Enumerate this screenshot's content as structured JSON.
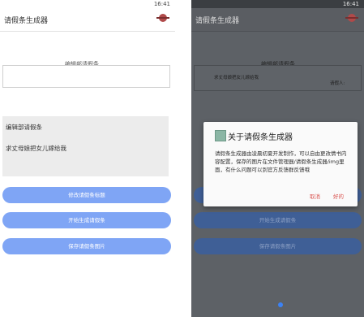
{
  "status_time": "16:41",
  "app": {
    "title": "请假条生成器"
  },
  "editor": {
    "legend": "编辑部请假条",
    "input_value": ""
  },
  "preview": {
    "title": "编辑部请假条",
    "body": "求丈母娘把女儿嫁给我"
  },
  "buttons": {
    "modify": "修改请假条标题",
    "generate": "开始生成请假条",
    "save": "保存请假条图片"
  },
  "right_preview": {
    "line1": "求丈母娘把女儿嫁给我",
    "signature": "请假人:"
  },
  "dialog": {
    "title": "关于请假条生成器",
    "message": "请假条生成器由凌晨初夏开发制作，可以自由更改情书内容配置，保存的图片在文件管理器/请假条生成器/img里面，有什么问题可以到官方反馈群反馈哦",
    "cancel": "取消",
    "ok": "好的"
  }
}
